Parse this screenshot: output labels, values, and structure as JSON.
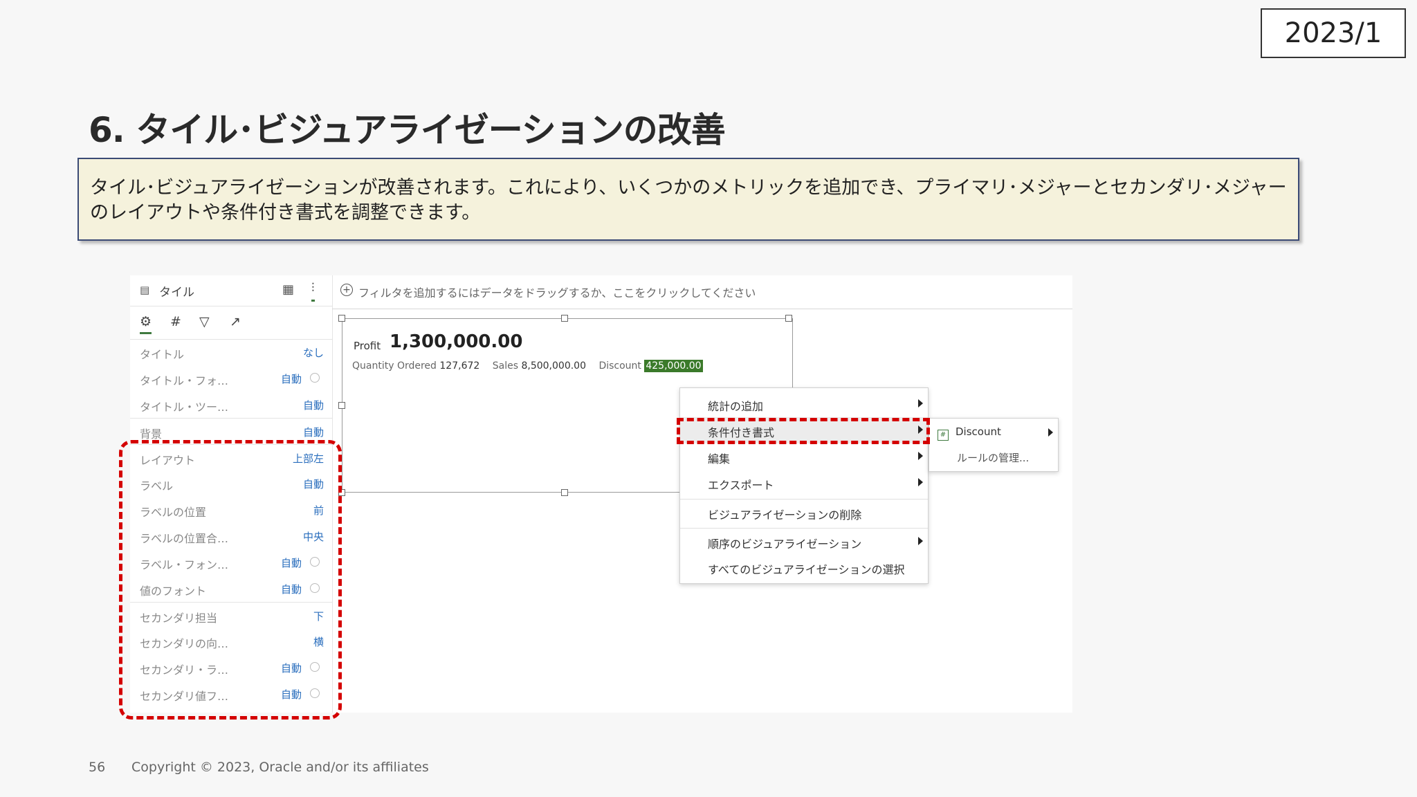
{
  "date": "2023/1",
  "title": "6. タイル･ビジュアライゼーションの改善",
  "description": "タイル･ビジュアライゼーションが改善されます。これにより、いくつかのメトリックを追加でき、プライマリ･メジャーとセカンダリ･メジャーのレイアウトや条件付き書式を調整できます。",
  "panel": {
    "header_title": "タイル",
    "rows": [
      {
        "label": "タイトル",
        "value": "なし"
      },
      {
        "label": "タイトル・フォ…",
        "value": "自動"
      },
      {
        "label": "タイトル・ツー…",
        "value": "自動"
      },
      {
        "label": "背景",
        "value": "自動"
      },
      {
        "label": "レイアウト",
        "value": "上部左"
      },
      {
        "label": "ラベル",
        "value": "自動"
      },
      {
        "label": "ラベルの位置",
        "value": "前"
      },
      {
        "label": "ラベルの位置合…",
        "value": "中央"
      },
      {
        "label": "ラベル・フォン…",
        "value": "自動"
      },
      {
        "label": "値のフォント",
        "value": "自動"
      },
      {
        "label": "セカンダリ担当",
        "value": "下"
      },
      {
        "label": "セカンダリの向…",
        "value": "横"
      },
      {
        "label": "セカンダリ・ラ…",
        "value": "自動"
      },
      {
        "label": "セカンダリ値フ…",
        "value": "自動"
      }
    ]
  },
  "filter_bar": {
    "text": "フィルタを追加するにはデータをドラッグするか、ここをクリックしてください"
  },
  "tile": {
    "primary_label": "Profit",
    "primary_value": "1,300,000.00",
    "metrics": [
      {
        "label": "Quantity Ordered",
        "value": "127,672"
      },
      {
        "label": "Sales",
        "value": "8,500,000.00"
      },
      {
        "label": "Discount",
        "value": "425,000.00"
      }
    ]
  },
  "context_menu": {
    "items": [
      "統計の追加",
      "条件付き書式",
      "編集",
      "エクスポート",
      "ビジュアライゼーションの削除",
      "順序のビジュアライゼーション",
      "すべてのビジュアライゼーションの選択"
    ]
  },
  "submenu": {
    "items": [
      "Discount",
      "ルールの管理..."
    ]
  },
  "footer": {
    "page": "56",
    "copyright": "Copyright © 2023, Oracle and/or its affiliates"
  },
  "colors": {
    "highlight": "#d40000",
    "accent_green": "#3f7a3f",
    "link_blue": "#2a6ebd",
    "desc_bg": "#f5f2dc"
  }
}
